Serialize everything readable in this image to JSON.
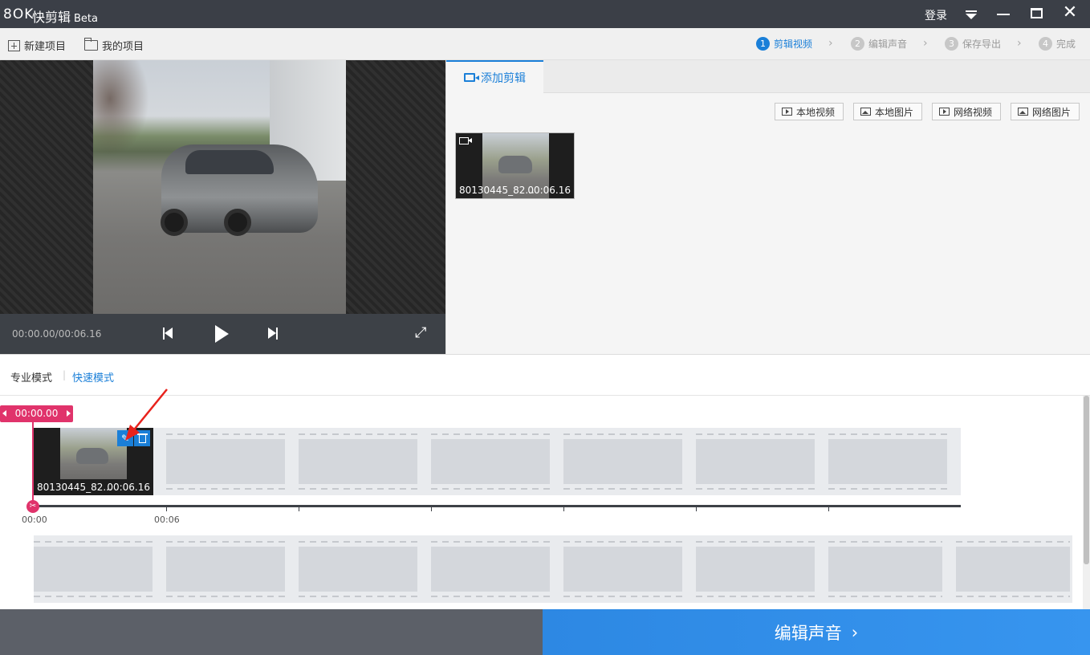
{
  "titlebar": {
    "logo": "8OK",
    "app_name": "快剪辑",
    "beta": "Beta",
    "login": "登录",
    "close_glyph": "✕"
  },
  "toolbar": {
    "new_project": "新建项目",
    "my_projects": "我的项目"
  },
  "steps": [
    {
      "num": "1",
      "label": "剪辑视频",
      "active": true
    },
    {
      "num": "2",
      "label": "编辑声音",
      "active": false
    },
    {
      "num": "3",
      "label": "保存导出",
      "active": false
    },
    {
      "num": "4",
      "label": "完成",
      "active": false
    }
  ],
  "step_sep": "›",
  "preview": {
    "time": "00:00.00/00:06.16",
    "fullscreen_glyph": "⤢"
  },
  "right_panel": {
    "tab_label": "添加剪辑",
    "sources": [
      "本地视频",
      "本地图片",
      "网络视频",
      "网络图片"
    ],
    "clip": {
      "name": "80130445_82...",
      "duration": "00:06.16"
    }
  },
  "modes": {
    "pro": "专业模式",
    "sep": "|",
    "fast": "快速模式"
  },
  "timeline": {
    "playhead_time": "00:00.00",
    "playhead_knob": "✂",
    "clip": {
      "name": "80130445_82...",
      "duration": "00:06.16"
    },
    "edit_glyph": "✎",
    "ruler_labels": [
      "00:00",
      "00:06"
    ]
  },
  "bottom": {
    "next_label": "编辑声音",
    "next_arrow": "›"
  },
  "colors": {
    "accent": "#1a7fd8",
    "playhead": "#e0336b",
    "titlebar": "#3b3f47"
  }
}
